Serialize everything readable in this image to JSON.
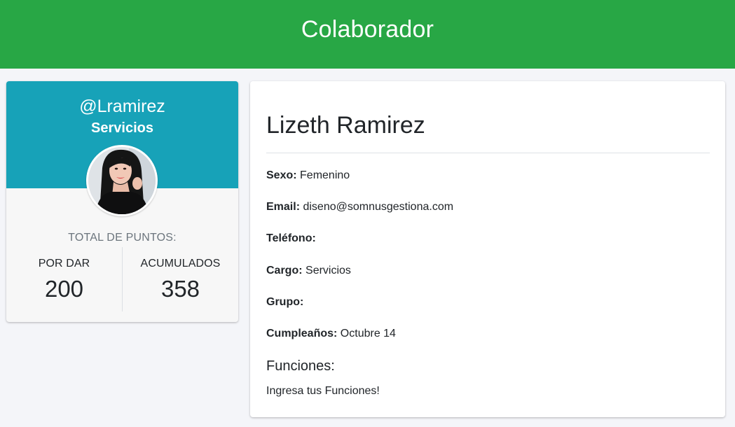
{
  "header": {
    "title": "Colaborador"
  },
  "profile": {
    "username": "@Lramirez",
    "department": "Servicios",
    "points_title": "TOTAL DE PUNTOS:",
    "points": [
      {
        "label": "POR DAR",
        "value": "200"
      },
      {
        "label": "ACUMULADOS",
        "value": "358"
      }
    ]
  },
  "details": {
    "name": "Lizeth Ramirez",
    "fields": [
      {
        "label": "Sexo:",
        "value": "Femenino"
      },
      {
        "label": "Email:",
        "value": "diseno@somnusgestiona.com"
      },
      {
        "label": "Teléfono:",
        "value": ""
      },
      {
        "label": "Cargo:",
        "value": "Servicios"
      },
      {
        "label": "Grupo:",
        "value": ""
      },
      {
        "label": "Cumpleaños:",
        "value": "Octubre 14"
      }
    ],
    "funciones_title": "Funciones:",
    "funciones_text": "Ingresa tus Funciones!"
  },
  "colors": {
    "header_bg": "#28a745",
    "profile_header_bg": "#17a2b8",
    "page_bg": "#f4f5f9"
  }
}
